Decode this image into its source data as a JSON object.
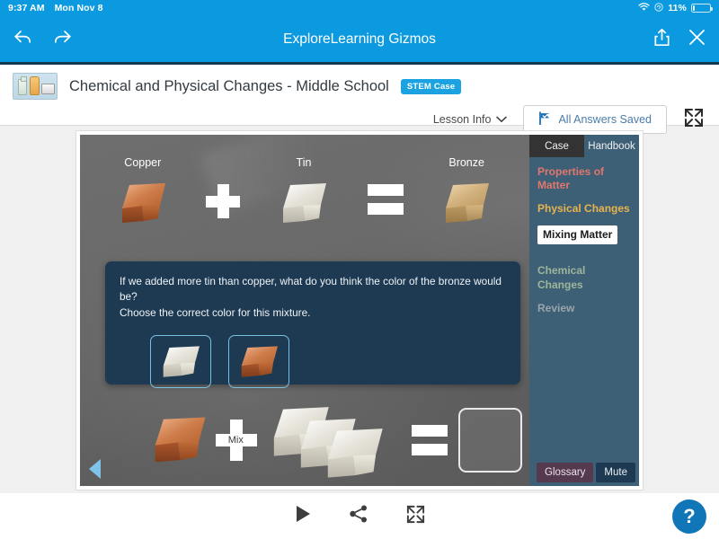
{
  "status_bar": {
    "time": "9:37 AM",
    "date": "Mon Nov 8",
    "battery_percent": "11%",
    "wifi_icon": "wifi-icon",
    "lock_icon": "screen-lock-icon"
  },
  "app_bar": {
    "title": "ExploreLearning Gizmos",
    "back_icon": "back-arrow-icon",
    "forward_icon": "forward-arrow-icon",
    "share_icon": "share-upload-icon",
    "close_icon": "close-x-icon",
    "accent_color": "#0b9ae0"
  },
  "lesson_header": {
    "thumbnail_name": "lesson-thumbnail",
    "title": "Chemical and Physical Changes - Middle School",
    "badge": "STEM Case",
    "badge_color": "#1aa3e0",
    "lesson_info_label": "Lesson Info",
    "chevron_icon": "chevron-down-icon",
    "saved_label": "All Answers Saved",
    "saved_icon": "flag-check-icon",
    "fullscreen_icon": "fullscreen-expand-icon"
  },
  "gizmo": {
    "equation_top": {
      "terms": [
        {
          "label": "Copper",
          "ingot": "copper-ingot"
        },
        {
          "label": "Tin",
          "ingot": "tin-ingot"
        },
        {
          "label": "Bronze",
          "ingot": "bronze-ingot"
        }
      ],
      "plus_symbol": "+",
      "equals_symbol": "="
    },
    "question": {
      "line1": "If we added more tin than copper, what do you think the color of the bronze would be?",
      "line2": "Choose the correct color for this mixture.",
      "choices": [
        {
          "name": "choice-pale-tin-ingot"
        },
        {
          "name": "choice-copper-ingot"
        }
      ],
      "panel_color": "#1e3a52",
      "choice_border_color": "#76c2e0"
    },
    "mixer": {
      "mix_label": "Mix",
      "copper_count": 1,
      "tin_count": 3,
      "result_placeholder_name": "mix-result-drop-target"
    },
    "prev_arrow_name": "previous-slide-arrow"
  },
  "side_panel": {
    "background_color": "#3d6077",
    "tabs": [
      {
        "label": "Case",
        "active": false
      },
      {
        "label": "Handbook",
        "active": true
      }
    ],
    "nav_items": [
      {
        "label": "Properties of Matter",
        "color": "#e2766b",
        "current": false
      },
      {
        "label": "Physical Changes",
        "color": "#e8b34e",
        "current": false
      },
      {
        "label": "Mixing Matter",
        "color": "#1b1b1b",
        "current": true
      },
      {
        "label": "Chemical Changes",
        "color": "#9fb59a",
        "current": false
      },
      {
        "label": "Review",
        "color": "#9aa5ab",
        "current": false
      }
    ],
    "glossary_label": "Glossary",
    "mute_label": "Mute"
  },
  "bottom_bar": {
    "play_icon": "play-triangle-icon",
    "share_icon": "share-nodes-icon",
    "fullscreen_icon": "fullscreen-expand-icon",
    "help_label": "?"
  }
}
